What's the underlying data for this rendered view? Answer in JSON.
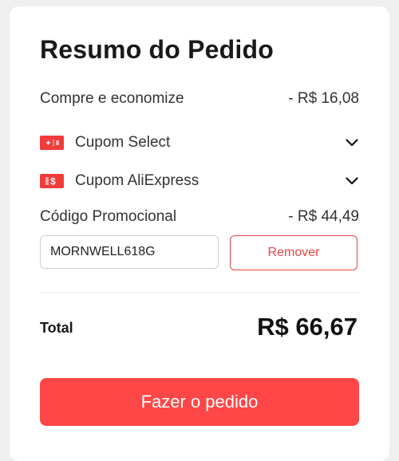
{
  "summary": {
    "title": "Resumo do Pedido",
    "save": {
      "label": "Compre e economize",
      "value": "- R$ 16,08"
    },
    "coupons": [
      {
        "label": "Cupom Select",
        "icon": "ticket-select-icon"
      },
      {
        "label": "Cupom AliExpress",
        "icon": "ticket-dollar-icon"
      }
    ],
    "promo": {
      "label": "Código Promocional",
      "value": "- R$ 44,49",
      "code": "MORNWELL618G",
      "remove_label": "Remover"
    },
    "total": {
      "label": "Total",
      "value": "R$ 66,67"
    },
    "order_button": "Fazer o pedido"
  },
  "colors": {
    "accent": "#ff4747",
    "badge": "#f23b3b",
    "remove": "#e64545"
  }
}
